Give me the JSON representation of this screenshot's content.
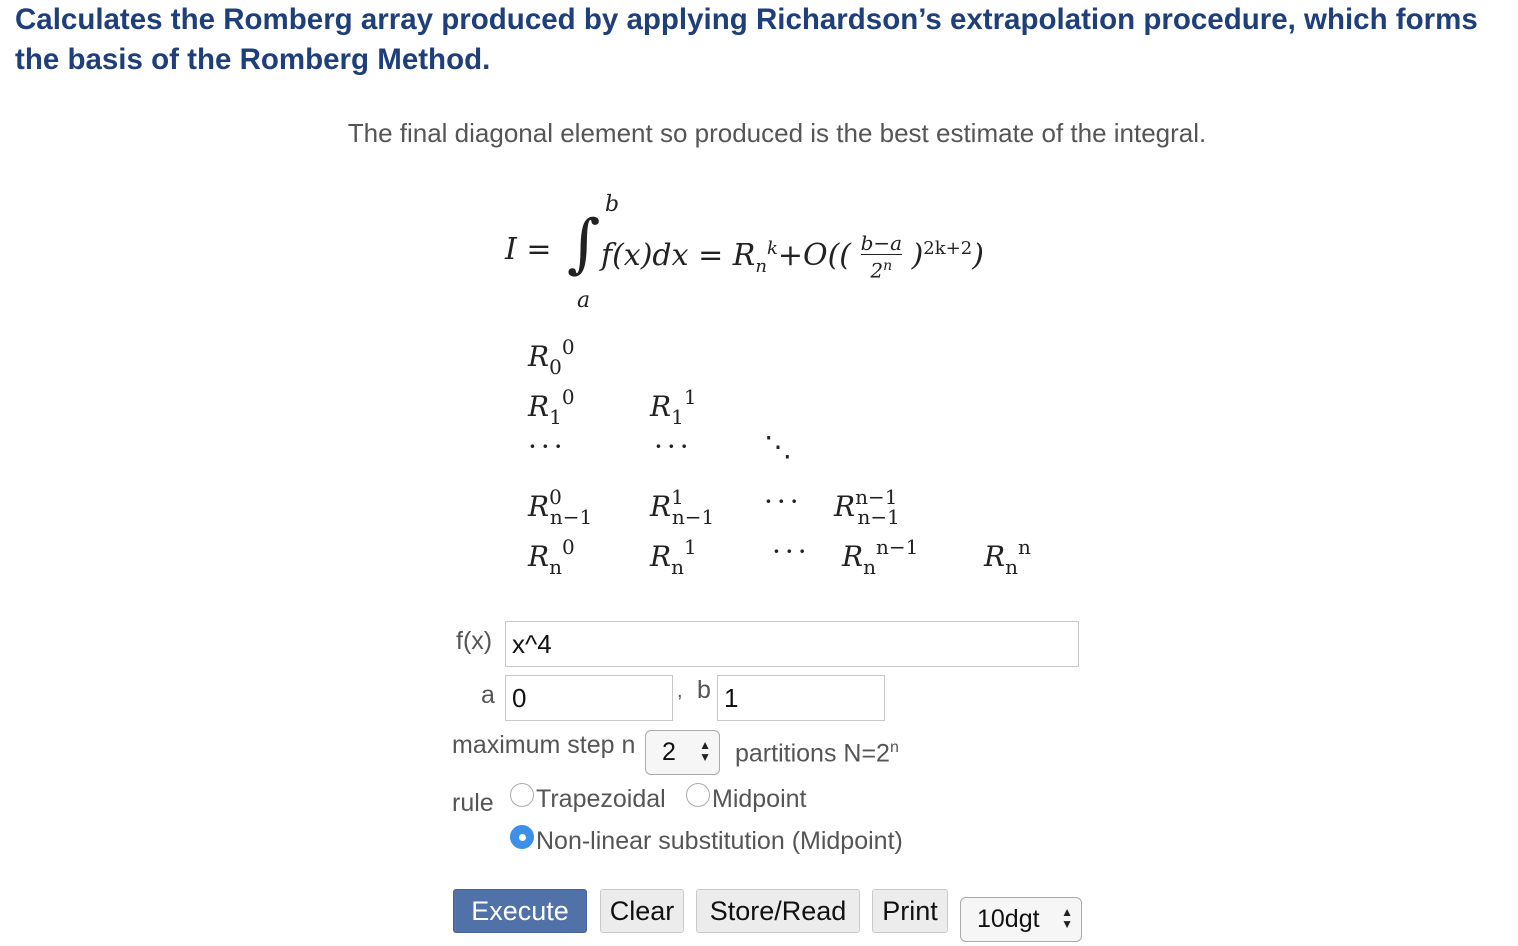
{
  "heading": "Calculates the Romberg array produced by applying Richardson’s extrapolation procedure, which forms the basis of the Romberg Method.",
  "intro": "The final diagonal element so produced is the best estimate of the integral.",
  "formula": {
    "lhs": "I =",
    "integrand": "f(x)dx = R",
    "upper_limit": "b",
    "lower_limit": "a",
    "rhs": "+O(((b−a)/2ⁿ)²ᵏ⁺²)"
  },
  "form": {
    "fx_label": "f(x)",
    "fx_value": "x^4",
    "a_label": "a",
    "a_value": "0",
    "comma": ",",
    "b_label": "b",
    "b_value": "1",
    "maxstep_label": "maximum step n",
    "maxstep_value": "2",
    "partitions_label": "partitions N=2",
    "partitions_sup": "n",
    "rule_label": "rule",
    "rule_options": [
      "Trapezoidal",
      "Midpoint",
      "Non-linear substitution (Midpoint)"
    ],
    "rule_selected": "Non-linear substitution (Midpoint)"
  },
  "buttons": {
    "execute": "Execute",
    "clear": "Clear",
    "store_read": "Store/Read",
    "print": "Print",
    "digits": "10dgt"
  },
  "colors": {
    "heading": "#1f3f7a",
    "execute_bg": "#5172a8",
    "radio_selected": "#3d8fe8"
  }
}
